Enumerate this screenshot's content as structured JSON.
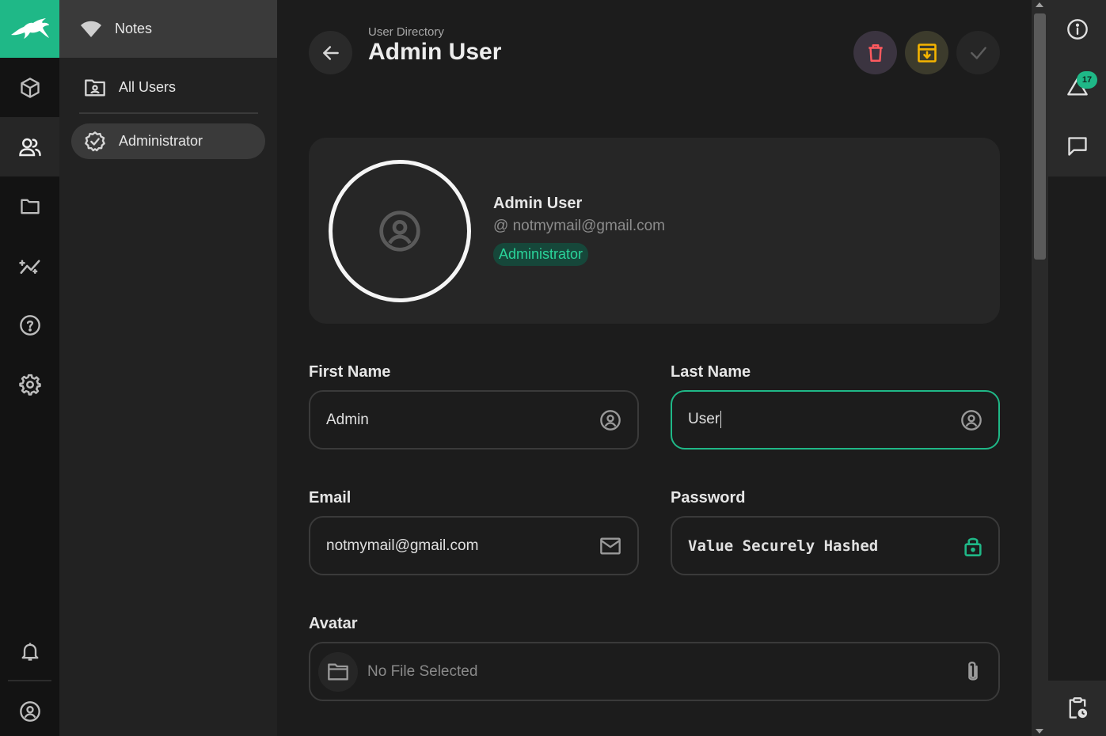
{
  "nav": {
    "header_label": "Notes",
    "items": [
      {
        "label": "All Users"
      },
      {
        "label": "Administrator"
      }
    ]
  },
  "page": {
    "breadcrumb": "User Directory",
    "title": "Admin User"
  },
  "profile": {
    "name": "Admin User",
    "email": "@ notmymail@gmail.com",
    "role": "Administrator"
  },
  "form": {
    "first_name": {
      "label": "First Name",
      "value": "Admin"
    },
    "last_name": {
      "label": "Last Name",
      "value": "User"
    },
    "email": {
      "label": "Email",
      "value": "notmymail@gmail.com"
    },
    "password": {
      "label": "Password",
      "value": "Value Securely Hashed"
    },
    "avatar": {
      "label": "Avatar",
      "placeholder": "No File Selected"
    }
  },
  "sidebar_right": {
    "notification_count": "17"
  },
  "colors": {
    "accent": "#1fb887",
    "delete": "#ff5a5f",
    "archive": "#f5b400",
    "background": "#1c1c1c"
  }
}
